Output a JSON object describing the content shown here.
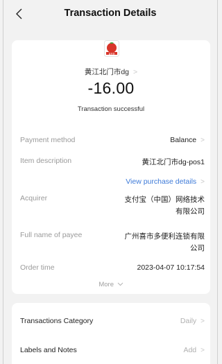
{
  "nav": {
    "title": "Transaction Details"
  },
  "summary": {
    "merchant": "黄江北门市dg",
    "amount": "-16.00",
    "status": "Transaction successful"
  },
  "details": {
    "payment_method_label": "Payment method",
    "payment_method_value": "Balance",
    "item_description_label": "Item description",
    "item_description_value": "黄江北门市dg-pos1",
    "view_purchase_details": "View purchase details",
    "acquirer_label": "Acquirer",
    "acquirer_value_line1": "支付宝（中国）网络技术",
    "acquirer_value_line2": "有限公司",
    "payee_label": "Full name of payee",
    "payee_value_line1": "广州喜市多便利连锁有限",
    "payee_value_line2": "公司",
    "order_time_label": "Order time",
    "order_time_value": "2023-04-07 10:17:54",
    "more": "More"
  },
  "extra": {
    "category_label": "Transactions Category",
    "category_value": "Daily",
    "labels_label": "Labels and Notes",
    "labels_value": "Add"
  },
  "logo": {
    "text": "喜市多"
  },
  "colors": {
    "link": "#3d7ad8",
    "logo_red": "#d8352a",
    "logo_green": "#3aa33a"
  }
}
